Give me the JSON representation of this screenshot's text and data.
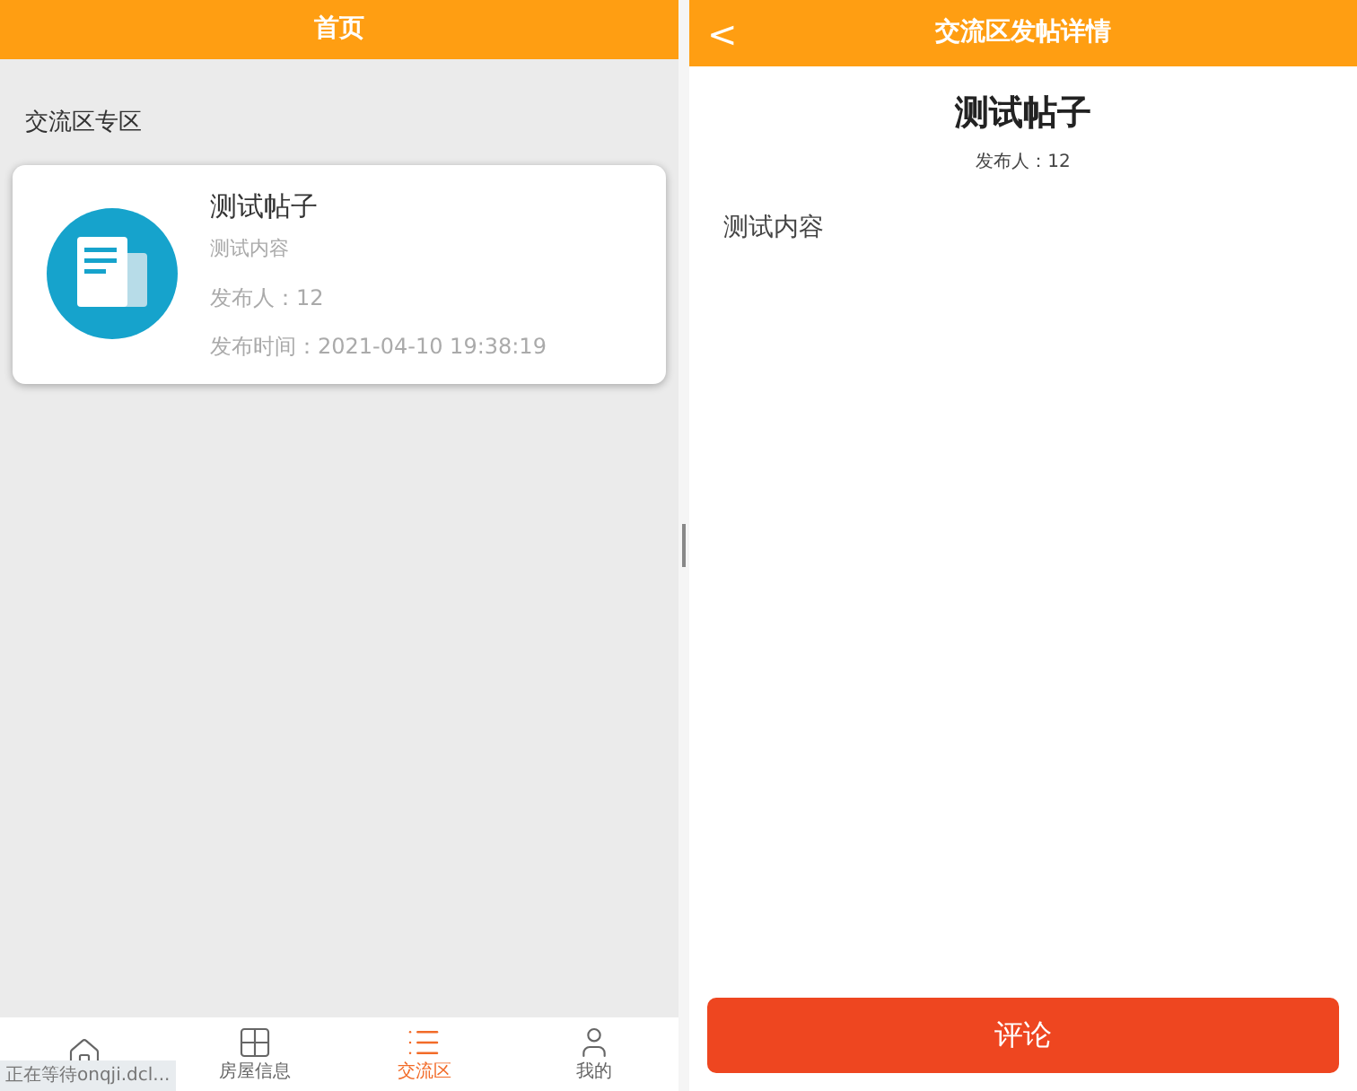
{
  "left_screen": {
    "title": "首页",
    "section_title": "交流区专区",
    "post_card": {
      "title": "测试帖子",
      "content": "测试内容",
      "author": "发布人：12",
      "time": "发布时间：2021-04-10 19:38:19"
    },
    "tab_bar": [
      {
        "selected": false
      },
      {
        "label": "房屋信息",
        "selected": false
      },
      {
        "label": "交流区",
        "selected": true
      },
      {
        "label": "我的",
        "selected": false
      }
    ],
    "status_overlay": "正在等待onqji.dcl..."
  },
  "right_screen": {
    "title": "交流区发帖详情",
    "back": "<",
    "post_title": "测试帖子",
    "author": "发布人：12",
    "content": "测试内容",
    "comment_button": "评论"
  }
}
